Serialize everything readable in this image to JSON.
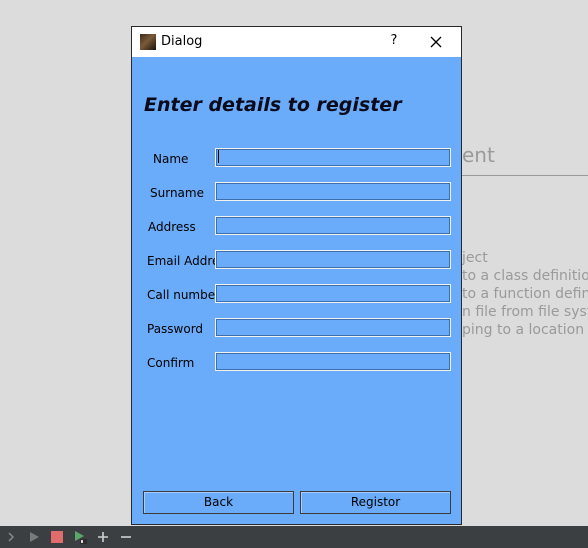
{
  "background": {
    "heading": "ent",
    "lines": [
      "ject",
      "to a class definition",
      "to a function definiti",
      "n file from file system",
      "ping to a location"
    ]
  },
  "toolbar": {
    "icons": [
      "chevron-right-icon",
      "run-icon",
      "stop-icon",
      "run-config-icon",
      "add-icon",
      "remove-icon"
    ]
  },
  "dialog": {
    "title": "Dialog",
    "help_label": "?",
    "heading": "Enter details to register",
    "fields": [
      {
        "label": "Name",
        "value": ""
      },
      {
        "label": "Surname",
        "value": ""
      },
      {
        "label": "Address",
        "value": ""
      },
      {
        "label": "Email Addres",
        "value": ""
      },
      {
        "label": "Call number",
        "value": ""
      },
      {
        "label": "Password",
        "value": ""
      },
      {
        "label": "Confirm",
        "value": ""
      }
    ],
    "back_label": "Back",
    "register_label": "Registor"
  },
  "colors": {
    "dialog_bg": "#6aabfa",
    "desktop_bg": "#dcdcdc",
    "bottom_bar": "#3c3f41"
  }
}
